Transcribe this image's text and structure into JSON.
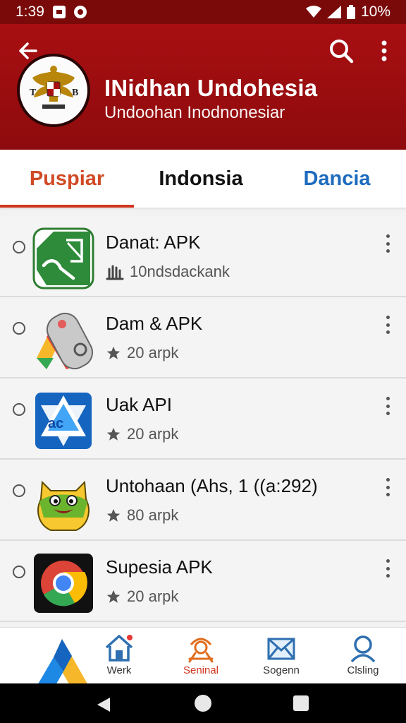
{
  "status_bar": {
    "time": "1:39",
    "battery": "10%"
  },
  "app_bar": {
    "title": "INidhan Undohesia",
    "subtitle": "Undoohan Inodnonesiar",
    "emblem_text": "T",
    "emblem_text_2": "B"
  },
  "tabs": [
    {
      "label": "Puspiar",
      "selected": true
    },
    {
      "label": "Indonsia",
      "selected": false
    },
    {
      "label": "Dancia",
      "selected": false
    }
  ],
  "list": [
    {
      "title": "Danat: APK",
      "subtitle": "10ndsdackank",
      "sub_icon": "hand-icon",
      "icon": "green-flag-app-icon"
    },
    {
      "title": "Dam & APK",
      "subtitle": "20 arpk",
      "sub_icon": "star-icon",
      "icon": "colorful-device-app-icon"
    },
    {
      "title": "Uak API",
      "subtitle": "20 arpk",
      "sub_icon": "star-icon",
      "icon": "blue-star-app-icon"
    },
    {
      "title": "Untohaan (Ahs, 1 ((a:292)",
      "subtitle": "80 arpk",
      "sub_icon": "star-icon",
      "icon": "green-monster-app-icon"
    },
    {
      "title": "Supesia APK",
      "subtitle": "20 arpk",
      "sub_icon": "star-icon",
      "icon": "chrome-app-icon"
    }
  ],
  "bottom_nav": [
    {
      "label": "Werk",
      "icon": "home-icon"
    },
    {
      "label": "Seninal",
      "icon": "antenna-icon",
      "selected": true
    },
    {
      "label": "Sogenn",
      "icon": "mail-icon"
    },
    {
      "label": "Clsling",
      "icon": "person-icon"
    }
  ],
  "colors": {
    "primary": "#a80f12",
    "tab_selected": "#d04a25",
    "tab_blue": "#1d6bbf"
  }
}
